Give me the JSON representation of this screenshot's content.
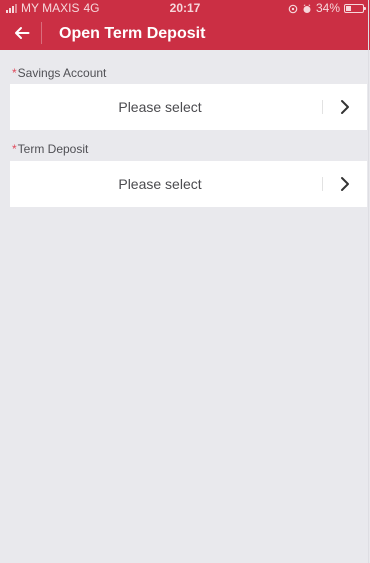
{
  "status_bar": {
    "carrier": "MY MAXIS",
    "network": "4G",
    "time": "20:17",
    "battery": "34%",
    "battery_level": 0.34,
    "icons": [
      "signal-icon",
      "location-icon",
      "alarm-icon",
      "battery-icon"
    ]
  },
  "header": {
    "back_icon": "arrow-left-icon",
    "title": "Open Term Deposit"
  },
  "form": {
    "savings_account": {
      "required_mark": "*",
      "label": "Savings Account",
      "value": "Please select",
      "chevron_icon": "chevron-right-icon"
    },
    "term_deposit": {
      "required_mark": "*",
      "label": "Term Deposit",
      "value": "Please select",
      "chevron_icon": "chevron-right-icon"
    }
  },
  "colors": {
    "header_background": "#cb2f44",
    "page_background": "#e9e9ed",
    "row_background": "#ffffff",
    "required": "#e04b5d"
  }
}
